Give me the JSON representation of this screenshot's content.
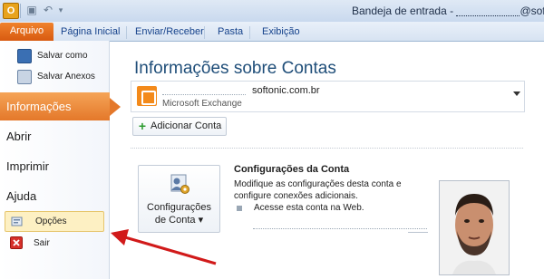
{
  "window": {
    "title_prefix": "Bandeja de entrada -",
    "title_suffix": "@softonic."
  },
  "ribbon": {
    "file_tab": "Arquivo",
    "tabs": [
      "Página Inicial",
      "Enviar/Receber",
      "Pasta",
      "Exibição"
    ]
  },
  "sidebar": {
    "save_as": "Salvar como",
    "save_attachments": "Salvar Anexos",
    "info": "Informações",
    "open": "Abrir",
    "print": "Imprimir",
    "help": "Ajuda",
    "options": "Opções",
    "exit": "Sair"
  },
  "main": {
    "heading": "Informações sobre Contas",
    "account": {
      "name": "softonic.com.br",
      "type": "Microsoft Exchange"
    },
    "add_account": "Adicionar Conta",
    "settings_button_line1": "Configurações",
    "settings_button_line2": "de Conta ▾",
    "settings_title": "Configurações da Conta",
    "settings_desc": "Modifique as configurações desta conta e configure conexões adicionais.",
    "web_access": "Acesse esta conta na Web."
  },
  "colors": {
    "accent_orange": "#e4782a",
    "title_blue": "#1f4e79",
    "arrow_red": "#d11a1a"
  }
}
